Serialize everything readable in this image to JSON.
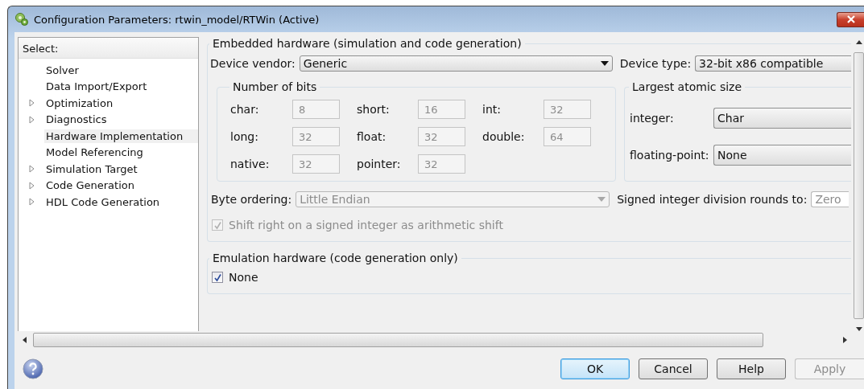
{
  "window": {
    "title": "Configuration Parameters: rtwin_model/RTWin (Active)"
  },
  "sidebar": {
    "heading": "Select:",
    "items": [
      {
        "label": "Solver",
        "expandable": false,
        "selected": false
      },
      {
        "label": "Data Import/Export",
        "expandable": false,
        "selected": false
      },
      {
        "label": "Optimization",
        "expandable": true,
        "selected": false
      },
      {
        "label": "Diagnostics",
        "expandable": true,
        "selected": false
      },
      {
        "label": "Hardware Implementation",
        "expandable": false,
        "selected": true
      },
      {
        "label": "Model Referencing",
        "expandable": false,
        "selected": false
      },
      {
        "label": "Simulation Target",
        "expandable": true,
        "selected": false
      },
      {
        "label": "Code Generation",
        "expandable": true,
        "selected": false
      },
      {
        "label": "HDL Code Generation",
        "expandable": true,
        "selected": false
      }
    ]
  },
  "embedded_hardware": {
    "title": "Embedded hardware (simulation and code generation)",
    "device_vendor": {
      "label": "Device vendor:",
      "value": "Generic"
    },
    "device_type": {
      "label": "Device type:",
      "value": "32-bit x86 compatible"
    },
    "number_of_bits": {
      "title": "Number of bits",
      "disabled": true,
      "fields": [
        {
          "label": "char:",
          "value": "8"
        },
        {
          "label": "short:",
          "value": "16"
        },
        {
          "label": "int:",
          "value": "32"
        },
        {
          "label": "long:",
          "value": "32"
        },
        {
          "label": "float:",
          "value": "32"
        },
        {
          "label": "double:",
          "value": "64"
        },
        {
          "label": "native:",
          "value": "32"
        },
        {
          "label": "pointer:",
          "value": "32"
        }
      ]
    },
    "largest_atomic_size": {
      "title": "Largest atomic size",
      "fields": [
        {
          "label": "integer:",
          "value": "Char"
        },
        {
          "label": "floating-point:",
          "value": "None"
        }
      ]
    },
    "byte_ordering": {
      "label": "Byte ordering:",
      "value": "Little Endian",
      "disabled": true
    },
    "division_rounding": {
      "label": "Signed integer division rounds to:",
      "value": "Zero",
      "disabled": true
    },
    "shift_right": {
      "label": "Shift right on a signed integer as arithmetic shift",
      "checked": true,
      "disabled": true
    }
  },
  "emulation_hardware": {
    "title": "Emulation hardware (code generation only)",
    "none": {
      "label": "None",
      "checked": true
    }
  },
  "buttons": [
    {
      "label": "OK",
      "kind": "default"
    },
    {
      "label": "Cancel",
      "kind": "normal"
    },
    {
      "label": "Help",
      "kind": "normal"
    },
    {
      "label": "Apply",
      "kind": "disabled"
    }
  ]
}
